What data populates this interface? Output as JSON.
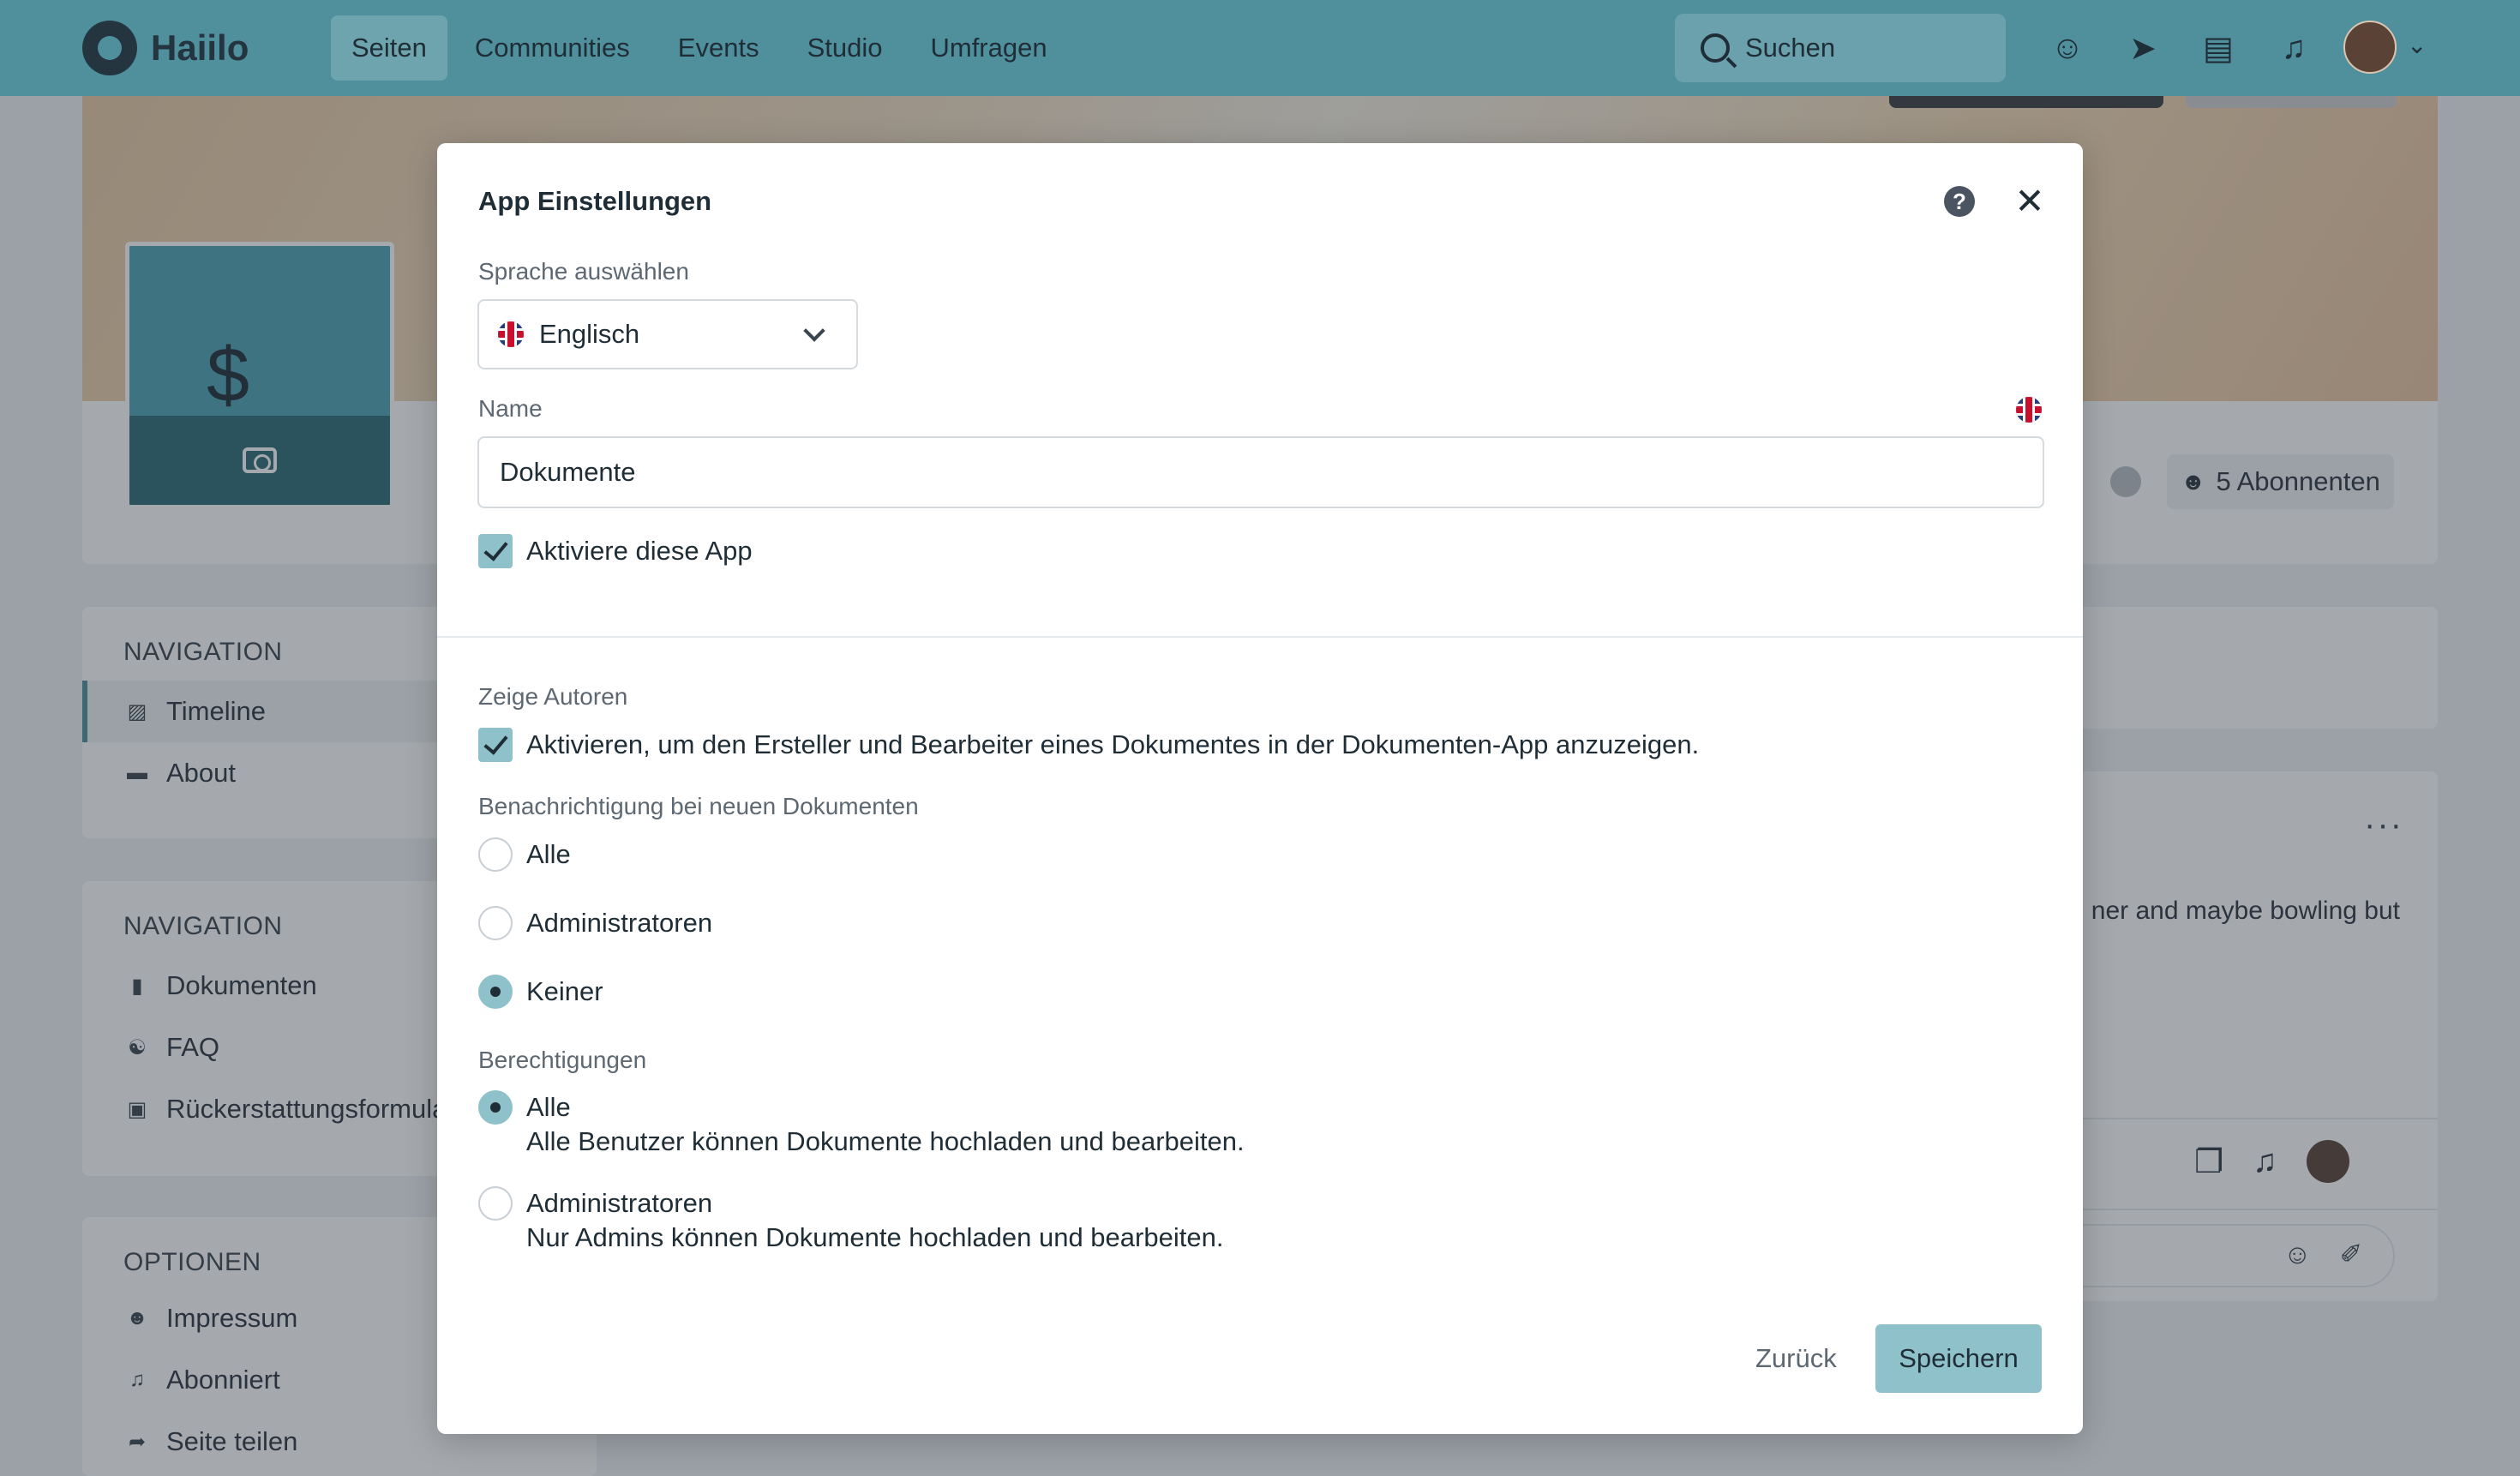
{
  "topbar": {
    "brand": "Haiilo",
    "nav": [
      "Seiten",
      "Communities",
      "Events",
      "Studio",
      "Umfragen"
    ],
    "search_placeholder": "Suchen",
    "icons": [
      "people-icon",
      "compass-icon",
      "clipboard-icon",
      "bell-icon"
    ]
  },
  "page": {
    "subscribers": "5 Abonnenten",
    "nav1": {
      "heading": "NAVIGATION",
      "items": [
        {
          "label": "Timeline",
          "icon": "timeline-icon",
          "active": true
        },
        {
          "label": "About",
          "icon": "about-icon",
          "active": false
        }
      ]
    },
    "nav2": {
      "heading": "NAVIGATION",
      "items": [
        {
          "label": "Dokumenten",
          "icon": "document-icon"
        },
        {
          "label": "FAQ",
          "icon": "faq-icon"
        },
        {
          "label": "Rückerstattungsformular",
          "icon": "form-icon"
        }
      ]
    },
    "options": {
      "heading": "OPTIONEN",
      "items": [
        {
          "label": "Impressum",
          "icon": "people-icon"
        },
        {
          "label": "Abonniert",
          "icon": "bell-icon"
        },
        {
          "label": "Seite teilen",
          "icon": "share-icon"
        }
      ]
    },
    "post_excerpt": "ner and maybe bowling but"
  },
  "modal": {
    "title": "App Einstellungen",
    "language_label": "Sprache auswählen",
    "language_value": "Englisch",
    "name_label": "Name",
    "name_value": "Dokumente",
    "activate_label": "Aktiviere diese App",
    "authors_label": "Zeige Autoren",
    "authors_check": "Aktivieren, um den Ersteller und Bearbeiter eines Dokumentes in der Dokumenten-App anzuzeigen.",
    "notify_label": "Benachrichtigung bei neuen Dokumenten",
    "notify_options": [
      {
        "label": "Alle",
        "selected": false
      },
      {
        "label": "Administratoren",
        "selected": false
      },
      {
        "label": "Keiner",
        "selected": true
      }
    ],
    "perm_label": "Berechtigungen",
    "perm_options": [
      {
        "label": "Alle",
        "desc": "Alle Benutzer können Dokumente hochladen und bearbeiten.",
        "selected": true
      },
      {
        "label": "Administratoren",
        "desc": "Nur Admins können Dokumente hochladen und bearbeiten.",
        "selected": false
      }
    ],
    "back_label": "Zurück",
    "save_label": "Speichern"
  },
  "colors": {
    "topbar": "#4f909c",
    "accent": "#8fc1cb",
    "page_logo": "#4fa2b3"
  }
}
